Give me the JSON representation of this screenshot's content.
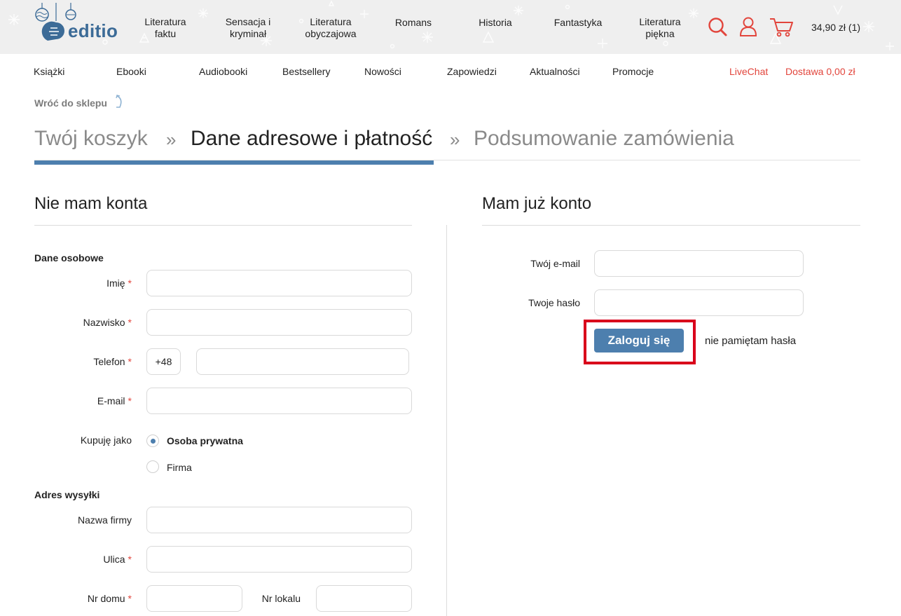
{
  "brand": {
    "name": "editio",
    "color": "#3c6b97"
  },
  "categories": [
    {
      "label": "Literatura\nfaktu"
    },
    {
      "label": "Sensacja i\nkryminał"
    },
    {
      "label": "Literatura\nobyczajowa"
    },
    {
      "label": "Romans"
    },
    {
      "label": "Historia"
    },
    {
      "label": "Fantastyka"
    },
    {
      "label": "Literatura\npiękna"
    }
  ],
  "header_icons": {
    "search": "search-icon",
    "account": "user-icon",
    "cart": "cart-icon"
  },
  "cart_total": "34,90 zł (1)",
  "nav": {
    "items": [
      "Książki",
      "Ebooki",
      "Audiobooki",
      "Bestsellery",
      "Nowości",
      "Zapowiedzi",
      "Aktualności",
      "Promocje"
    ],
    "livechat": "LiveChat",
    "delivery": "Dostawa 0,00 zł"
  },
  "back_link": "Wróć do sklepu",
  "steps": {
    "step1": "Twój koszyk",
    "sep": "»",
    "step2": "Dane adresowe i płatność",
    "step3": "Podsumowanie zamówienia",
    "active": 2
  },
  "no_account": {
    "title": "Nie mam konta",
    "personal_section": "Dane osobowe",
    "first_name_label": "Imię",
    "last_name_label": "Nazwisko",
    "phone_label": "Telefon",
    "phone_prefix": "+48",
    "email_label": "E-mail",
    "buying_as_label": "Kupuję jako",
    "buyer_options": [
      "Osoba prywatna",
      "Firma"
    ],
    "buyer_selected": "Osoba prywatna",
    "shipping_section": "Adres wysyłki",
    "company_label": "Nazwa firmy",
    "street_label": "Ulica",
    "house_no_label": "Nr domu",
    "flat_no_label": "Nr lokalu",
    "required_mark": "*"
  },
  "has_account": {
    "title": "Mam już konto",
    "email_label": "Twój e-mail",
    "password_label": "Twoje hasło",
    "login_button": "Zaloguj się",
    "forgot_link": "nie pamiętam hasła"
  },
  "colors": {
    "accent": "#4d7fae",
    "red": "#e2453c",
    "highlight": "#d9001b"
  }
}
